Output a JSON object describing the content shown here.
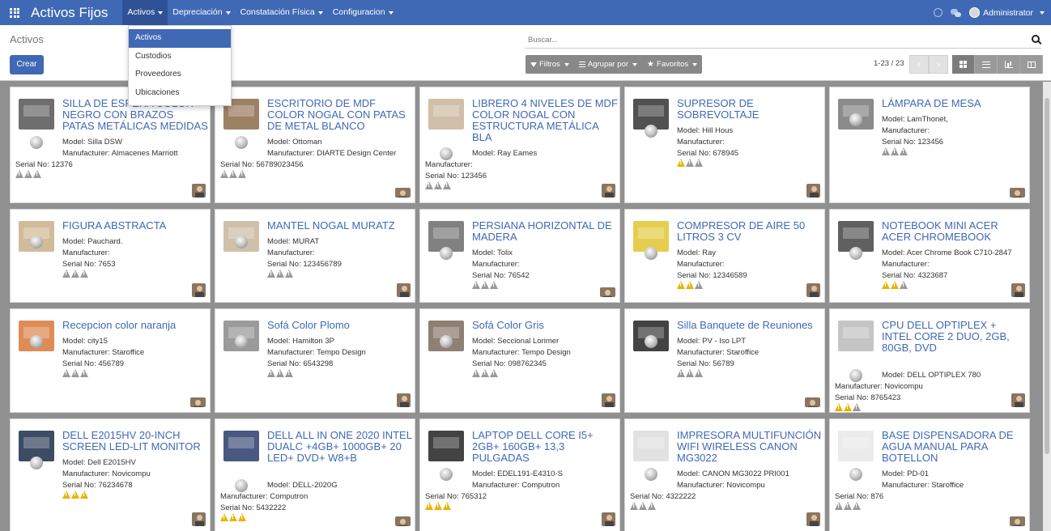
{
  "app_title": "Activos Fijos",
  "menu": [
    {
      "label": "Activos"
    },
    {
      "label": "Depreciación"
    },
    {
      "label": "Constatación Física"
    },
    {
      "label": "Configuracion"
    }
  ],
  "user": {
    "name": "Administrator"
  },
  "dropdown": [
    {
      "label": "Activos",
      "active": true
    },
    {
      "label": "Custodios"
    },
    {
      "label": "Proveedores"
    },
    {
      "label": "Ubicaciones"
    }
  ],
  "control": {
    "title": "Activos",
    "create": "Crear",
    "search_placeholder": "Buscar...",
    "filters": "Filtros",
    "groupby": "Agrupar por",
    "favorites": "Favoritos",
    "pager": "1-23 / 23"
  },
  "cards": [
    {
      "title": "SILLA DE ESPERA COLOR NEGRO CON BRAZOS PATAS METÁLICAS MEDIDAS",
      "model": "Model: Silla DSW",
      "manufacturer": "Manufacturer: Almacenes Marriott",
      "serial": "Serial No: 12376",
      "warn_on": 0
    },
    {
      "title": "ESCRITORIO DE MDF COLOR NOGAL CON PATAS DE METAL BLANCO",
      "model": "Model: Ottoman",
      "manufacturer": "Manufacturer: DIARTE Design Center",
      "serial": "Serial No: 56789023456",
      "warn_on": 0
    },
    {
      "title": "LIBRERO 4 NIVELES DE MDF COLOR NOGAL CON ESTRUCTURA METÁLICA BLA",
      "model": "Model: Ray Eames",
      "manufacturer": "Manufacturer:",
      "serial": "Serial No: 123456",
      "warn_on": 0
    },
    {
      "title": "SUPRESOR DE SOBREVOLTAJE",
      "model": "Model: Hill Hous",
      "manufacturer": "Manufacturer:",
      "serial": "Serial No: 678945",
      "warn_on": 1
    },
    {
      "title": "LÁMPARA DE MESA",
      "model": "Model: LamThonet,",
      "manufacturer": "Manufacturer:",
      "serial": "Serial No: 123456",
      "warn_on": 0
    },
    {
      "title": "FIGURA ABSTRACTA",
      "model": "Model: Pauchard.",
      "manufacturer": "Manufacturer:",
      "serial": "Serial No: 7653",
      "warn_on": 0
    },
    {
      "title": "MANTEL NOGAL MURATZ",
      "model": "Model: MURAT",
      "manufacturer": "Manufacturer:",
      "serial": "Serial No: 123456789",
      "warn_on": 0
    },
    {
      "title": "PERSIANA HORIZONTAL DE MADERA",
      "model": "Model: Tolix",
      "manufacturer": "Manufacturer:",
      "serial": "Serial No: 76542",
      "warn_on": 0
    },
    {
      "title": "COMPRESOR DE AIRE 50 LITROS 3 CV",
      "model": "Model: Ray",
      "manufacturer": "Manufacturer:",
      "serial": "Serial No: 12346589",
      "warn_on": 2
    },
    {
      "title": "NOTEBOOK MINI ACER ACER CHROMEBOOK",
      "model": "Model: Acer Chrome Book C710-2847",
      "manufacturer": "Manufacturer:",
      "serial": "Serial No: 4323687",
      "warn_on": 2
    },
    {
      "title": "Recepcion color naranja",
      "model": "Model: city15",
      "manufacturer": "Manufacturer: Staroffice",
      "serial": "Serial No: 456789",
      "warn_on": 0
    },
    {
      "title": "Sofá Color Plomo",
      "model": "Model: Hamilton 3P",
      "manufacturer": "Manufacturer: Tempo Design",
      "serial": "Serial No: 6543298",
      "warn_on": 0
    },
    {
      "title": "Sofá Color Gris",
      "model": "Model: Seccional Lorimer",
      "manufacturer": "Manufacturer: Tempo Design",
      "serial": "Serial No: 098762345",
      "warn_on": 0
    },
    {
      "title": "Silla Banquete de Reuniones",
      "model": "Model: PV - Iso LPT",
      "manufacturer": "Manufacturer: Staroffice",
      "serial": "Serial No: 56789",
      "warn_on": 0
    },
    {
      "title": "CPU DELL OPTIPLEX + INTEL CORE 2 DUO, 2GB, 80GB, DVD",
      "model": "Model: DELL OPTIPLEX 780",
      "manufacturer": "Manufacturer: Novicompu",
      "serial": "Serial No: 8765423",
      "warn_on": 2
    },
    {
      "title": "DELL E2015HV 20-INCH SCREEN LED-LIT MONITOR",
      "model": "Model: Dell E2015HV",
      "manufacturer": "Manufacturer: Novicompu",
      "serial": "Serial No: 76234678",
      "warn_on": 3
    },
    {
      "title": "DELL ALL IN ONE 2020 INTEL DUALC +4GB+ 1000GB+ 20 LED+ DVD+ W8+B",
      "model": "Model: DELL-2020G",
      "manufacturer": "Manufacturer: Computron",
      "serial": "Serial No: 5432222",
      "warn_on": 3
    },
    {
      "title": "LAPTOP DELL CORE I5+ 2GB+ 160GB+ 13,3 PULGADAS",
      "model": "Model: EDEL191-E4310-S",
      "manufacturer": "Manufacturer: Computron",
      "serial": "Serial No: 765312",
      "warn_on": 3
    },
    {
      "title": "IMPRESORA MULTIFUNCIÓN WIFI WIRELESS CANON MG3022",
      "model": "Model: CANON MG3022 PRI001",
      "manufacturer": "Manufacturer: Novicompu",
      "serial": "Serial No: 4322222",
      "warn_on": 0
    },
    {
      "title": "BASE DISPENSADORA DE AGUA MANUAL PARA BOTELLON",
      "model": "Model: PD-01",
      "manufacturer": "Manufacturer: Staroffice",
      "serial": "Serial No: 876",
      "warn_on": 0
    }
  ]
}
